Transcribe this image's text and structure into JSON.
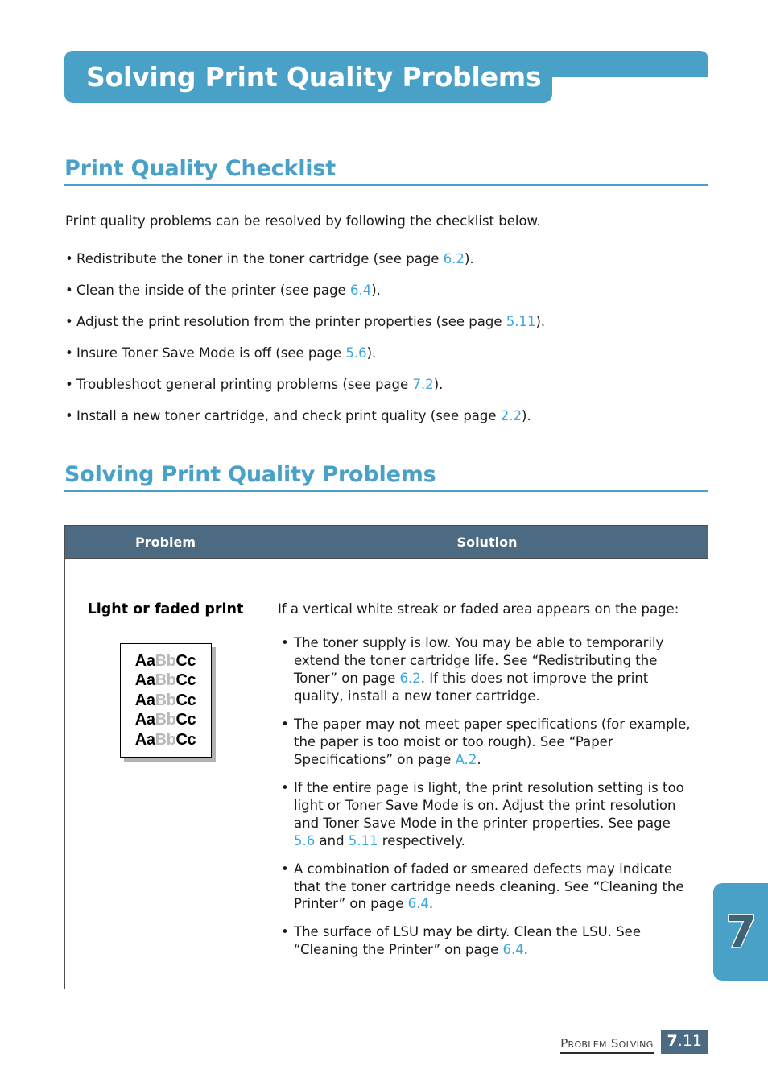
{
  "banner": {
    "title": "Solving Print Quality Problems",
    "color": "#4aa1c8"
  },
  "sections": {
    "checklist": {
      "heading": "Print Quality Checklist",
      "intro": "Print quality problems can be resolved by following the checklist below.",
      "bullet_glyph": "•",
      "items": [
        {
          "pre": "Redistribute the toner in the toner cartridge (see page ",
          "ref": "6.2",
          "post": ")."
        },
        {
          "pre": "Clean the inside of the printer (see page ",
          "ref": "6.4",
          "post": ")."
        },
        {
          "pre": "Adjust the print resolution from the printer properties (see page ",
          "ref": "5.11",
          "post": ")."
        },
        {
          "pre": "Insure Toner Save Mode is off (see page ",
          "ref": "5.6",
          "post": ")."
        },
        {
          "pre": "Troubleshoot general printing problems (see page ",
          "ref": "7.2",
          "post": ")."
        },
        {
          "pre": "Install a new toner cartridge, and check print quality (see page ",
          "ref": "2.2",
          "post": ")."
        }
      ]
    },
    "solving": {
      "heading": "Solving Print Quality Problems"
    }
  },
  "table": {
    "header_bg": "#4c6b82",
    "columns": {
      "problem": "Problem",
      "solution": "Solution"
    },
    "row": {
      "problem_label": "Light or faded print",
      "sample": {
        "lines": [
          {
            "black1": "Aa",
            "gray": "Bb",
            "black2": "Cc"
          },
          {
            "black1": "Aa",
            "gray": "Bb",
            "black2": "Cc"
          },
          {
            "black1": "Aa",
            "gray": "Bb",
            "black2": "Cc"
          },
          {
            "black1": "Aa",
            "gray": "Bb",
            "black2": "Cc"
          },
          {
            "black1": "Aa",
            "gray": "Bb",
            "black2": "Cc"
          }
        ],
        "faded_color": "#b9b9b9"
      },
      "solution_lead": "If a vertical white streak or faded area appears on the page:",
      "solution_bullet_glyph": "•",
      "solution_items": [
        {
          "part1": "The toner supply is low. You may be able to temporarily extend the toner cartridge life. See “Redistributing the Toner” on page ",
          "ref1": "6.2",
          "part2": ". If this does not improve the print quality, install a new toner cartridge.",
          "ref2": "",
          "part3": ""
        },
        {
          "part1": "The paper may not meet paper specifications (for example, the paper is too moist or too rough). See “Paper Specifications” on page ",
          "ref1": "A.2",
          "part2": ".",
          "ref2": "",
          "part3": ""
        },
        {
          "part1": "If the entire page is light, the print resolution setting is too light or Toner Save Mode is on. Adjust the print resolution and Toner Save Mode in the printer properties. See page ",
          "ref1": "5.6",
          "part2": " and ",
          "ref2": "5.11",
          "part3": " respectively."
        },
        {
          "part1": "A combination of faded or smeared defects may indicate that the toner cartridge needs cleaning. See “Cleaning the Printer” on page ",
          "ref1": "6.4",
          "part2": ".",
          "ref2": "",
          "part3": ""
        },
        {
          "part1": "The surface of LSU may be dirty. Clean the LSU. See “Cleaning the Printer” on page ",
          "ref1": "6.4",
          "part2": ".",
          "ref2": "",
          "part3": ""
        }
      ]
    }
  },
  "page_tab": {
    "number": "7"
  },
  "footer": {
    "label": "Problem Solving",
    "page_major": "7",
    "page_minor": ".11"
  }
}
